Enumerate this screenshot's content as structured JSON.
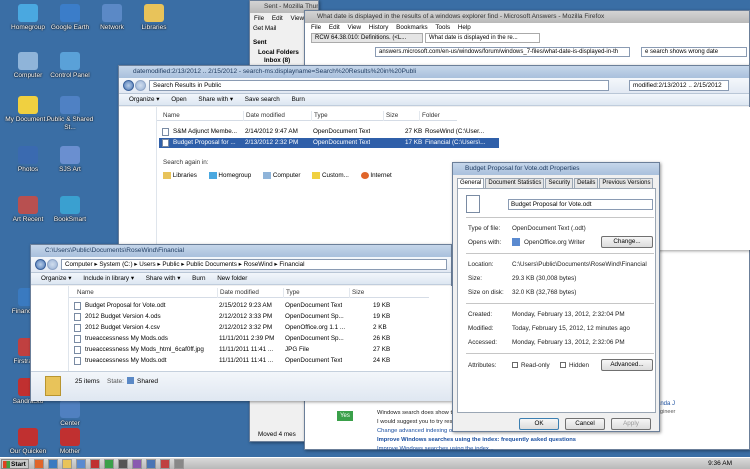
{
  "desktop": {
    "icons": [
      {
        "label": "Homegroup",
        "color": "#4aa8e0"
      },
      {
        "label": "Google Earth",
        "color": "#3b7dc9"
      },
      {
        "label": "Network",
        "color": "#5b89c6"
      },
      {
        "label": "Libraries",
        "color": "#e8c35a"
      },
      {
        "label": "Computer",
        "color": "#8fb4d9"
      },
      {
        "label": "Control Panel",
        "color": "#5aa1d8"
      },
      {
        "label": "My Document...",
        "color": "#f0d040"
      },
      {
        "label": "Public & Shared St...",
        "color": "#4f81c4"
      },
      {
        "label": "Photos",
        "color": "#3a6ab0"
      },
      {
        "label": "SJS Art",
        "color": "#6a8fd0"
      },
      {
        "label": "Art Recent",
        "color": "#b85050"
      },
      {
        "label": "BookSmart",
        "color": "#3aa0d0"
      },
      {
        "label": "Finance Fo",
        "color": "#3a7ac0"
      },
      {
        "label": "Firstraven",
        "color": "#c04040"
      },
      {
        "label": "SandraSto",
        "color": "#c03030"
      },
      {
        "label": "Center",
        "color": "#5080c0"
      },
      {
        "label": "Our Quicken",
        "color": "#c03030"
      },
      {
        "label": "Mother",
        "color": "#c03030"
      }
    ]
  },
  "thunderbird": {
    "title": "Sent - Mozilla Thunderbird",
    "menu": [
      "File",
      "Edit",
      "View"
    ],
    "get_mail": "Get Mail",
    "folder_sent": "Sent",
    "folder_local": "Local Folders",
    "folder_inbox": "Inbox (8)",
    "moved_status": "Moved 4 mes"
  },
  "firefox": {
    "title": "What date is displayed in the results of a windows explorer find - Microsoft Answers - Mozilla Firefox",
    "menu": [
      "File",
      "Edit",
      "View",
      "History",
      "Bookmarks",
      "Tools",
      "Help"
    ],
    "tab1": "RCW 64.38.010: Definitions. (<L...",
    "tab2": "What date is displayed in the re...",
    "url": "answers.microsoft.com/en-us/windows/forum/windows_7-files/what-date-is-displayed-in-th",
    "search": "e search shows wrong date",
    "page_lines": [
      "Windows search does show t",
      "I would suggest you to try res",
      "Change advanced indexing o",
      "Improve Windows searches using the index: frequently asked questions",
      "Improve Windows searches using the index..."
    ],
    "yes_label": "Yes",
    "side_name": "anda J",
    "side_role": "ngineer"
  },
  "search_window": {
    "title": "datemodified:2/13/2012 .. 2/15/2012 - search-ms:displayname=Search%20Results%20in%20Publi",
    "address": "Search Results in Public",
    "search_box": "modified:2/13/2012 .. 2/15/2012",
    "toolbar": [
      "Organize ▾",
      "Open",
      "Share with ▾",
      "Save search",
      "Burn"
    ],
    "columns": [
      "Name",
      "Date modified",
      "Type",
      "Size",
      "Folder"
    ],
    "rows": [
      [
        "S&M Adjunct Membe...",
        "2/14/2012 9:47 AM",
        "OpenDocument Text",
        "27 KB",
        "RoseWind (C:\\User..."
      ],
      [
        "Budget Proposal for ...",
        "2/13/2012 2:32 PM",
        "OpenDocument Text",
        "17 KB",
        "Financial (C:\\Users\\..."
      ]
    ],
    "search_again": "Search again in:",
    "search_targets": [
      "Libraries",
      "Homegroup",
      "Computer",
      "Custom...",
      "Internet"
    ]
  },
  "financial_window": {
    "title": "C:\\Users\\Public\\Documents\\RoseWind\\Financial",
    "breadcrumb": [
      "Computer",
      "System (C:)",
      "Users",
      "Public",
      "Public Documents",
      "RoseWind",
      "Financial"
    ],
    "toolbar": [
      "Organize ▾",
      "Include in library ▾",
      "Share with ▾",
      "Burn",
      "New folder"
    ],
    "columns": [
      "Name",
      "Date modified",
      "Type",
      "Size"
    ],
    "rows": [
      [
        "Budget Proposal for Vote.odt",
        "2/15/2012 9:23 AM",
        "OpenDocument Text",
        "19 KB"
      ],
      [
        "2012 Budget Version 4.ods",
        "2/12/2012 3:33 PM",
        "OpenDocument Sp...",
        "19 KB"
      ],
      [
        "2012 Budget Version 4.csv",
        "2/12/2012 3:32 PM",
        "OpenOffice.org 1.1 ...",
        "2 KB"
      ],
      [
        "trueaccessness My Mods.ods",
        "11/11/2011 2:39 PM",
        "OpenDocument Sp...",
        "26 KB"
      ],
      [
        "trueaccessness My Mods_html_6caf0ff.jpg",
        "11/11/2011 11:41 ...",
        "JPG File",
        "27 KB"
      ],
      [
        "trueaccessness My Mods.odt",
        "11/11/2011 11:41 ...",
        "OpenDocument Text",
        "24 KB"
      ]
    ],
    "status_count": "25 items",
    "status_state_label": "State:",
    "status_state": "Shared"
  },
  "properties": {
    "title": "Budget Proposal for Vote.odt Properties",
    "tabs": [
      "General",
      "Document Statistics",
      "Security",
      "Details",
      "Previous Versions"
    ],
    "filename": "Budget Proposal for Vote.odt",
    "type_label": "Type of file:",
    "type_value": "OpenDocument Text (.odt)",
    "opens_label": "Opens with:",
    "opens_value": "OpenOffice.org Writer",
    "change_btn": "Change...",
    "location_label": "Location:",
    "location_value": "C:\\Users\\Public\\Documents\\RoseWind\\Financial",
    "size_label": "Size:",
    "size_value": "29.3 KB (30,008 bytes)",
    "disk_label": "Size on disk:",
    "disk_value": "32.0 KB (32,768 bytes)",
    "created_label": "Created:",
    "created_value": "Monday, February 13, 2012, 2:32:04 PM",
    "modified_label": "Modified:",
    "modified_value": "Today, February 15, 2012, 12 minutes ago",
    "accessed_label": "Accessed:",
    "accessed_value": "Monday, February 13, 2012, 2:32:06 PM",
    "attributes_label": "Attributes:",
    "readonly_label": "Read-only",
    "hidden_label": "Hidden",
    "advanced_btn": "Advanced...",
    "ok_btn": "OK",
    "cancel_btn": "Cancel",
    "apply_btn": "Apply"
  },
  "taskbar": {
    "start": "Start",
    "clock": "9:36 AM"
  }
}
